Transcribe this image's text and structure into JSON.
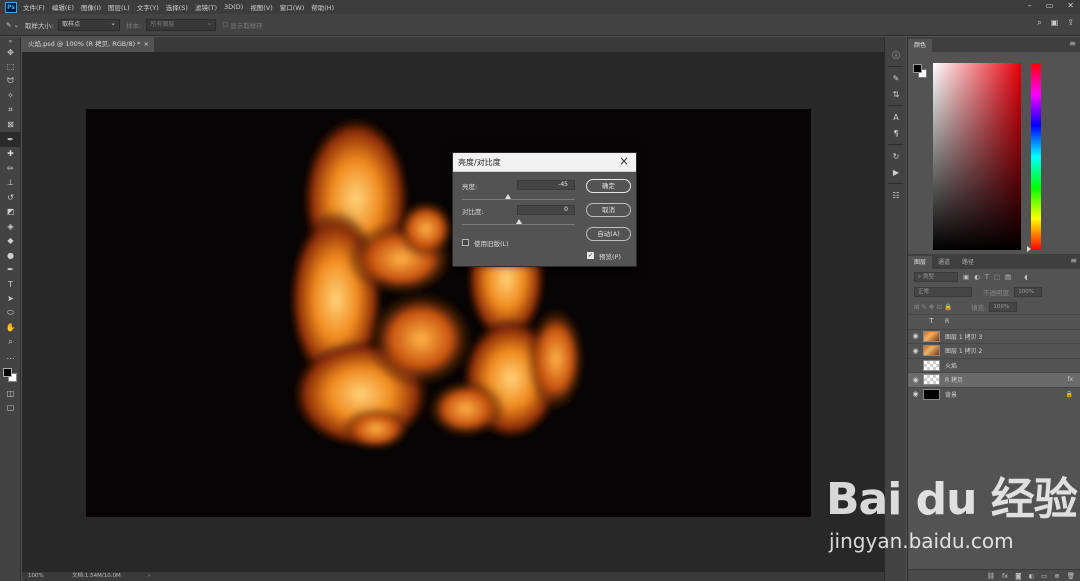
{
  "app": {
    "logo": "Ps"
  },
  "menu": [
    "文件(F)",
    "编辑(E)",
    "图像(I)",
    "图层(L)",
    "文字(Y)",
    "选择(S)",
    "滤镜(T)",
    "3D(D)",
    "视图(V)",
    "窗口(W)",
    "帮助(H)"
  ],
  "options_bar": {
    "sample_size_label": "取样大小:",
    "sample_size_value": "取样点",
    "sample_label": "样本:",
    "sample_value": "所有图层",
    "show_ring_label": "显示取样环"
  },
  "document": {
    "tab_title": "火焰.psd @ 100% (R 拷贝, RGB/8) *",
    "zoom": "100%",
    "doc_info": "文档:1.54M/10.0M"
  },
  "dialog": {
    "title": "亮度/对比度",
    "brightness_label": "亮度:",
    "brightness_value": "-45",
    "brightness_level": 0.41,
    "contrast_label": "对比度:",
    "contrast_value": "0",
    "contrast_level": 0.5,
    "use_legacy_label": "使用旧版(L)",
    "use_legacy_checked": false,
    "ok_label": "确定",
    "cancel_label": "取消",
    "auto_label": "自动(A)",
    "preview_label": "预览(P)",
    "preview_checked": true
  },
  "color_panel": {
    "tab": "颜色",
    "foreground": "#000000",
    "background": "#ffffff",
    "hue_color": "#e8000b"
  },
  "layers_panel": {
    "tabs": [
      "图层",
      "通道",
      "路径"
    ],
    "kind_filter": "类型",
    "blend_mode": "正常",
    "opacity_label": "不透明度:",
    "opacity_value": "100%",
    "fill_label": "填充:",
    "fill_value": "100%",
    "layers": [
      {
        "name": "R",
        "visible": false,
        "thumb": "type",
        "selected": false,
        "badge": ""
      },
      {
        "name": "图层 1 拷贝 3",
        "visible": true,
        "thumb": "fire",
        "selected": false,
        "badge": ""
      },
      {
        "name": "图层 1 拷贝 2",
        "visible": true,
        "thumb": "fire",
        "selected": false,
        "badge": ""
      },
      {
        "name": "火焰",
        "visible": false,
        "thumb": "check",
        "selected": false,
        "badge": ""
      },
      {
        "name": "R 拷贝",
        "visible": true,
        "thumb": "check",
        "selected": true,
        "badge": "fx"
      },
      {
        "name": "背景",
        "visible": true,
        "thumb": "black",
        "selected": false,
        "badge": "🔒"
      }
    ]
  },
  "watermark": {
    "brand": "Bai du 经验",
    "url": "jingyan.baidu.com"
  },
  "colors": {
    "app_bg": "#535353",
    "canvas_bg": "#060404",
    "dialog_title_bg": "#f2f2f2"
  }
}
